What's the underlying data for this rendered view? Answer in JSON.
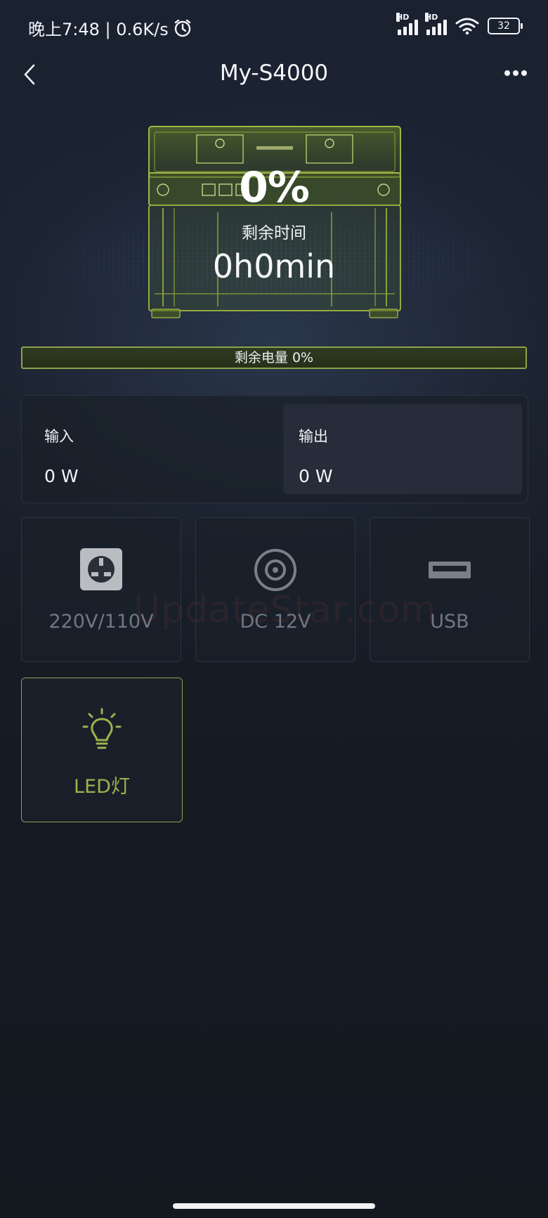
{
  "status_bar": {
    "time_text": "晚上7:48 | 0.6K/s",
    "network_tag_1": "HD",
    "network_tag_2": "HD",
    "battery_level": "32"
  },
  "header": {
    "title": "My-S4000"
  },
  "hero": {
    "percent": "0%",
    "remaining_label": "剩余时间",
    "remaining_time": "0h0min"
  },
  "charge_bar": {
    "label": "剩余电量 0%",
    "fill_fraction": 0
  },
  "io": {
    "input_label": "输入",
    "input_value": "0 W",
    "output_label": "输出",
    "output_value": "0 W"
  },
  "tiles": [
    {
      "label": "220V/110V",
      "icon": "ac-outlet-icon",
      "active": false
    },
    {
      "label": "DC 12V",
      "icon": "dc-port-icon",
      "active": false
    },
    {
      "label": "USB",
      "icon": "usb-port-icon",
      "active": false
    },
    {
      "label": "LED灯",
      "icon": "light-bulb-icon",
      "active": true
    }
  ],
  "watermark": "UpdateStar.com",
  "colors": {
    "accent": "#9bb34e",
    "bar_border": "#8ea24a",
    "background": "#14181f"
  }
}
